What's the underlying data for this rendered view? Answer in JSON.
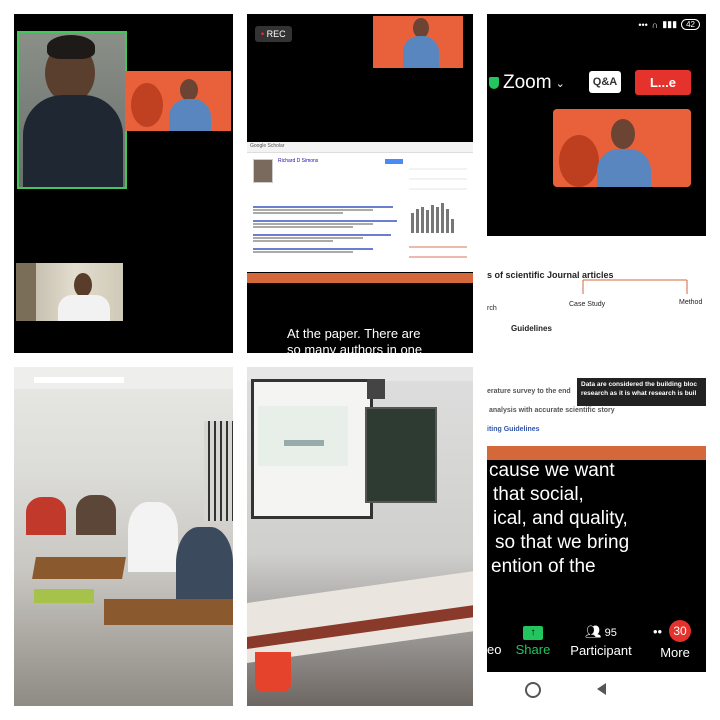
{
  "tile2": {
    "rec_label": "REC",
    "scholar": {
      "site_name": "Google Scholar",
      "profile_name": "Richard D Simons",
      "caption_lines": [
        "At the paper. There are",
        "so many authors in one"
      ]
    }
  },
  "tile3": {
    "status": {
      "battery": "42"
    },
    "app_title": "Zoom",
    "qa_label": "Q&A",
    "leave_label": "L...e",
    "slide": {
      "heading": "s of scientific Journal articles",
      "node_case_study": "Case Study",
      "node_method": "Method",
      "node_search": "rch",
      "guidelines": "Guidelines",
      "survey_line": "erature survey to the end",
      "highlight_line1": "Data are considered the building bloc",
      "highlight_line2": "research as it is what research is buil",
      "analysis_line": "analysis with accurate scientific story",
      "writing_guidelines": "iting Guidelines"
    },
    "caption_lines": [
      "cause we want",
      "that social,",
      "ical, and quality,",
      "so that we bring",
      "ention of the"
    ],
    "toolbar": {
      "video_label": "eo",
      "share_label": "Share",
      "participants_count": "95",
      "participants_label": "Participant",
      "more_label": "More",
      "more_badge": "30"
    }
  },
  "colors": {
    "zoom_green": "#22c55e",
    "leave_red": "#e5322c",
    "slide_orange": "#d5683a",
    "speaker_border": "#44c75a"
  }
}
